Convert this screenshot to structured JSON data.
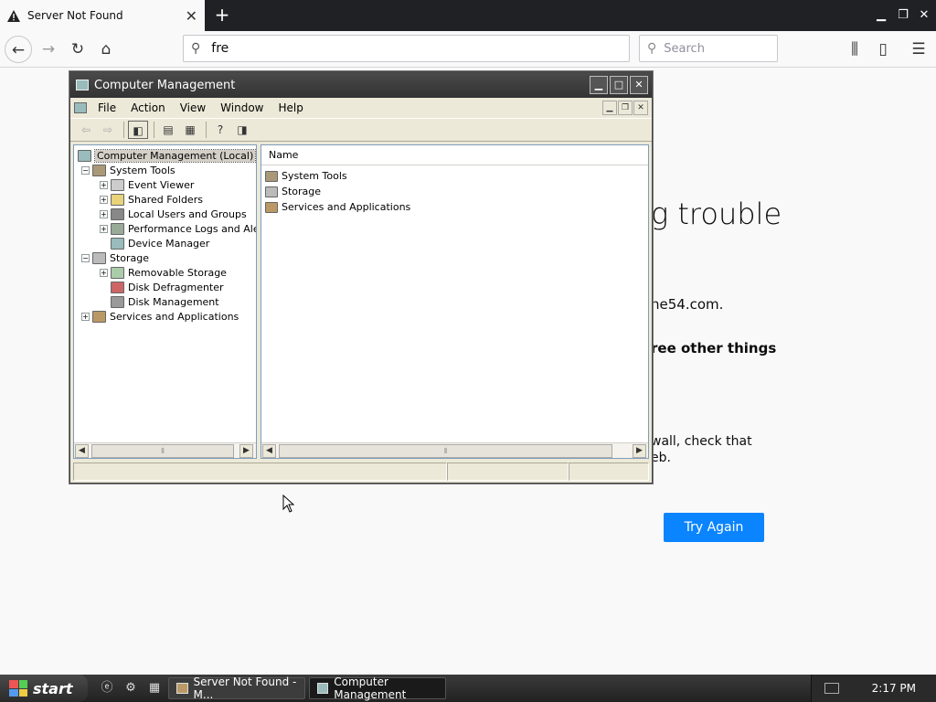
{
  "browser": {
    "tab_title": "Server Not Found",
    "url_text": "fre",
    "search_placeholder": "Search"
  },
  "error_page": {
    "title_partial": "g trouble",
    "line1_partial": "ne54.com.",
    "line2_partial": "ree other things",
    "line3_partial": "wall, check that",
    "line4_partial": "eb.",
    "try_again_label": "Try Again",
    "button_color": "#0a84ff"
  },
  "cm_window": {
    "title": "Computer Management",
    "menu": [
      "File",
      "Action",
      "View",
      "Window",
      "Help"
    ],
    "tree": [
      {
        "label": "Computer Management (Local)",
        "selected": true
      },
      {
        "label": "System Tools"
      },
      {
        "label": "Event Viewer"
      },
      {
        "label": "Shared Folders"
      },
      {
        "label": "Local Users and Groups"
      },
      {
        "label": "Performance Logs and Alerts"
      },
      {
        "label": "Device Manager"
      },
      {
        "label": "Storage"
      },
      {
        "label": "Removable Storage"
      },
      {
        "label": "Disk Defragmenter"
      },
      {
        "label": "Disk Management"
      },
      {
        "label": "Services and Applications"
      }
    ],
    "list_header": "Name",
    "list_items": [
      "System Tools",
      "Storage",
      "Services and Applications"
    ]
  },
  "taskbar": {
    "start_label": "start",
    "tasks": [
      "Server Not Found - M...",
      "Computer Management"
    ],
    "clock": "2:17 PM"
  },
  "colors": {
    "accent": "#0a84ff",
    "titlebar": "#3a3a3a",
    "taskbar": "#2a2a2a"
  }
}
